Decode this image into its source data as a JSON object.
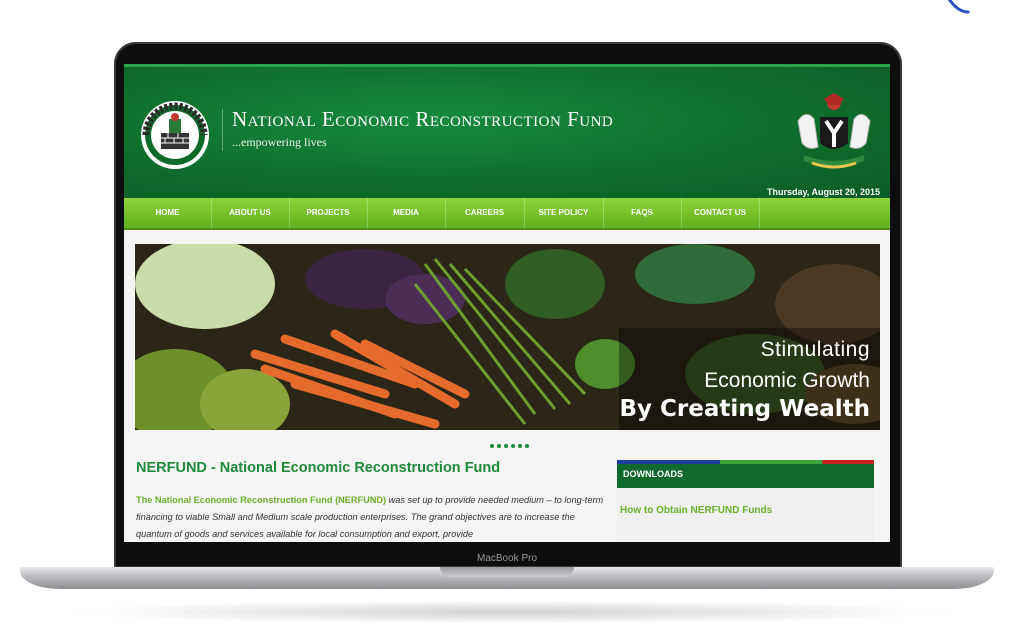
{
  "site": {
    "title": "National Economic Reconstruction Fund",
    "tagline": "...empowering lives",
    "logo_text": "NERFUND",
    "date": "Thursday, August 20, 2015"
  },
  "nav": [
    {
      "label": "HOME"
    },
    {
      "label": "ABOUT US"
    },
    {
      "label": "PROJECTS"
    },
    {
      "label": "MEDIA"
    },
    {
      "label": "CAREERS"
    },
    {
      "label": "SITE POLICY"
    },
    {
      "label": "FAQS"
    },
    {
      "label": "CONTACT US"
    }
  ],
  "slider": {
    "line1": "Stimulating",
    "line2": "Economic Growth",
    "line3": "By Creating Wealth",
    "dot_count": 6
  },
  "content": {
    "heading": "NERFUND - National Economic Reconstruction Fund",
    "lead": "The National Economic Reconstruction Fund (NERFUND)",
    "body": " was set up to provide needed medium – to long-term financing to viable Small and Medium scale production enterprises. The grand objectives are to increase the quantum of goods and services available for local consumption and export, provide"
  },
  "downloads": {
    "heading": "DOWNLOADS",
    "link": "How to Obtain NERFUND Funds"
  },
  "device": {
    "model": "MacBook Pro"
  },
  "colors": {
    "header_green": "#0f6e2d",
    "nav_green": "#7ac52e",
    "link_green": "#6bb02a"
  }
}
